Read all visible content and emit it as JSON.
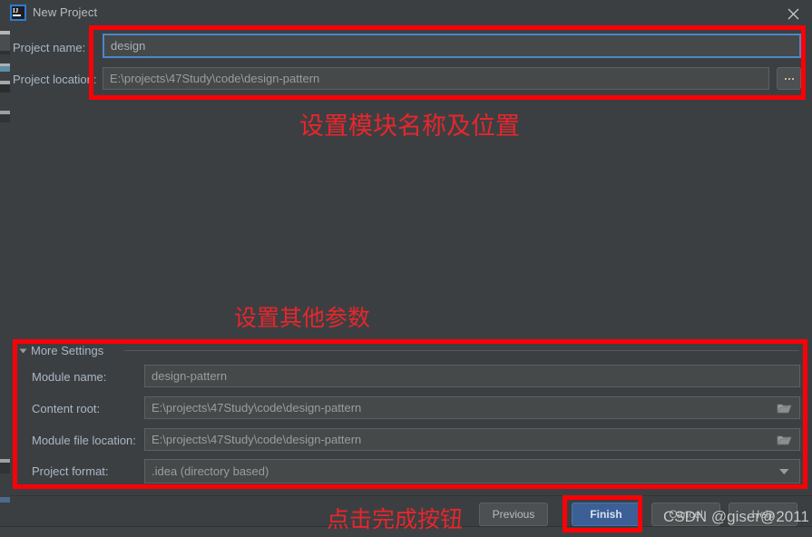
{
  "window": {
    "title": "New Project",
    "app_icon": "intellij-idea-icon",
    "close_icon": "close-icon"
  },
  "top_section": {
    "fields": [
      {
        "label": "Project name:",
        "value": "design",
        "focused": true,
        "trailing_icon": null
      },
      {
        "label": "Project location:",
        "value": "E:\\projects\\47Study\\code\\design-pattern",
        "focused": false,
        "trailing_icon": "ellipsis-browse-icon"
      }
    ]
  },
  "more_settings": {
    "group_title": "More Settings",
    "collapse_icon": "triangle-down-icon",
    "expanded": true,
    "fields": [
      {
        "label": "Module name:",
        "value": "design-pattern",
        "trailing_icon": null
      },
      {
        "label": "Content root:",
        "value": "E:\\projects\\47Study\\code\\design-pattern",
        "trailing_icon": "folder-icon"
      },
      {
        "label": "Module file location:",
        "value": "E:\\projects\\47Study\\code\\design-pattern",
        "trailing_icon": "folder-icon"
      },
      {
        "label": "Project format:",
        "value": ".idea (directory based)",
        "trailing_icon": "chevron-down-icon"
      }
    ]
  },
  "buttons": {
    "previous": "Previous",
    "finish": "Finish",
    "cancel": "Cancel",
    "help": "Help"
  },
  "annotations": {
    "top": "设置模块名称及位置",
    "middle": "设置其他参数",
    "bottom": "点击完成按钮",
    "color": "#fb0007"
  },
  "watermark": {
    "text": "CSDN @giser@2011"
  },
  "colors": {
    "dialog_bg": "#3c3f41",
    "field_bg": "#45494a",
    "focus_border": "#4a88c7",
    "primary_button": "#3c6096",
    "annotation_red": "#fb0007",
    "label_text": "#a9b7c6"
  }
}
